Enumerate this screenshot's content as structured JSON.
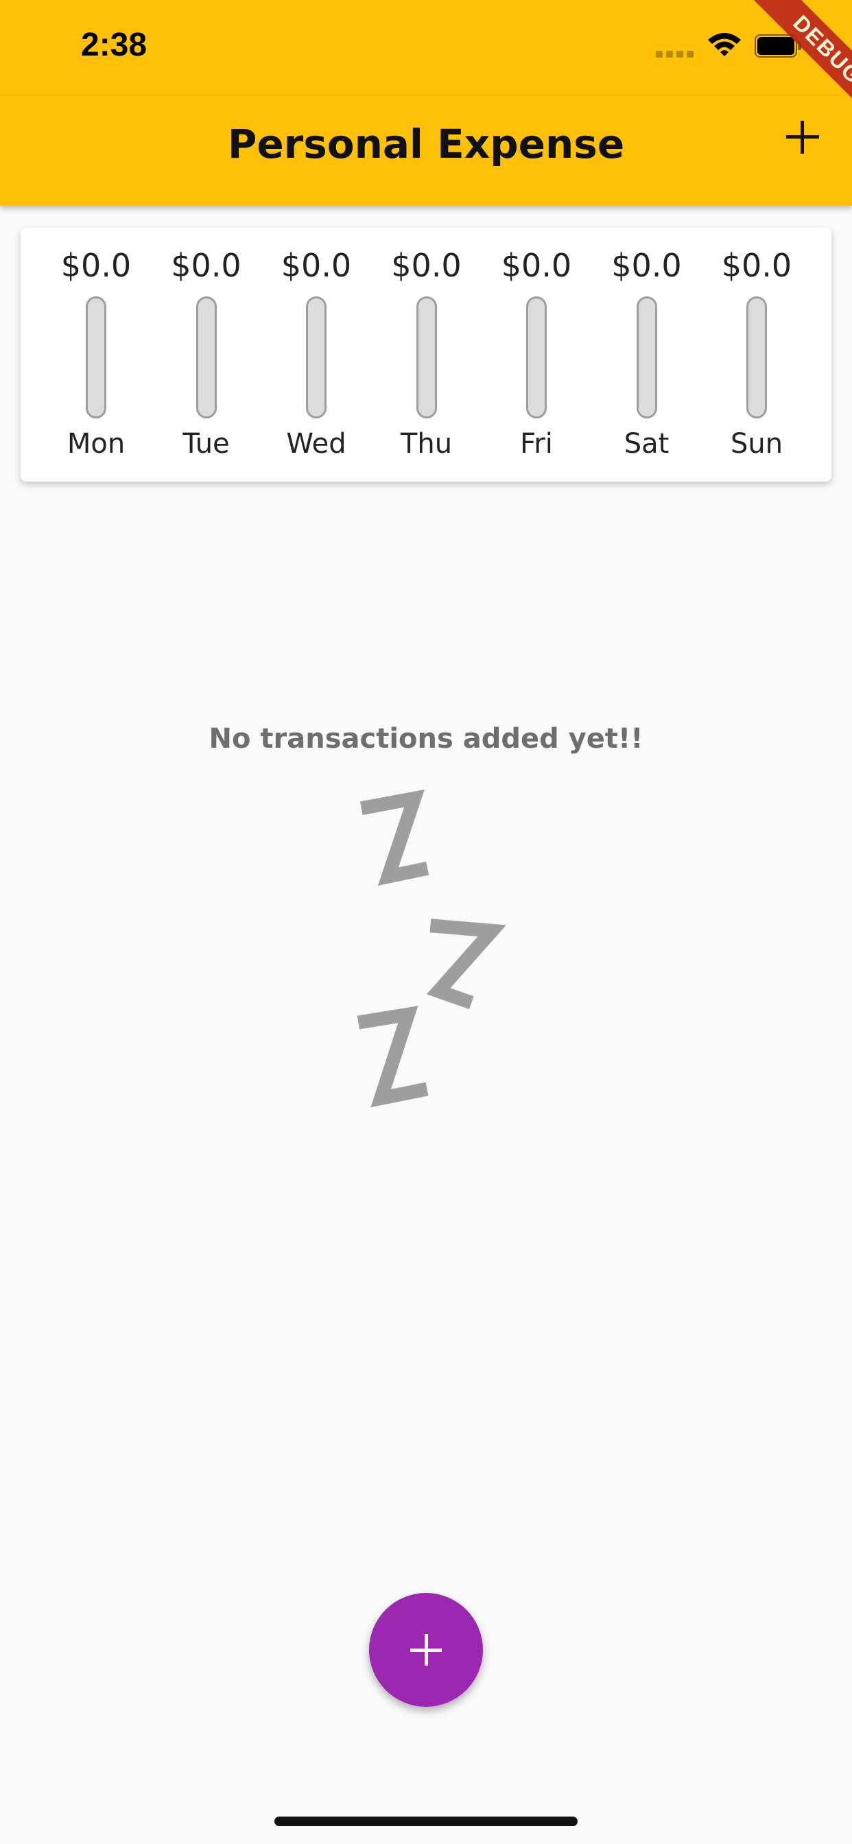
{
  "status_bar": {
    "time": "2:38"
  },
  "app_bar": {
    "title": "Personal Expense",
    "action_icon": "plus-icon"
  },
  "debug_banner": {
    "text": "DEBUG",
    "color": "#b71c1c"
  },
  "chart": {
    "days": [
      {
        "day": "Mon",
        "amount": "$0.0",
        "fraction": 0
      },
      {
        "day": "Tue",
        "amount": "$0.0",
        "fraction": 0
      },
      {
        "day": "Wed",
        "amount": "$0.0",
        "fraction": 0
      },
      {
        "day": "Thu",
        "amount": "$0.0",
        "fraction": 0
      },
      {
        "day": "Fri",
        "amount": "$0.0",
        "fraction": 0
      },
      {
        "day": "Sat",
        "amount": "$0.0",
        "fraction": 0
      },
      {
        "day": "Sun",
        "amount": "$0.0",
        "fraction": 0
      }
    ]
  },
  "empty_state": {
    "message": "No transactions added yet!!",
    "illustration": "zzz-sleep-icon"
  },
  "fab": {
    "icon": "plus-icon"
  },
  "colors": {
    "primary": "#ffc107",
    "accent": "#9c27b0",
    "track": "#dcdcdc"
  }
}
